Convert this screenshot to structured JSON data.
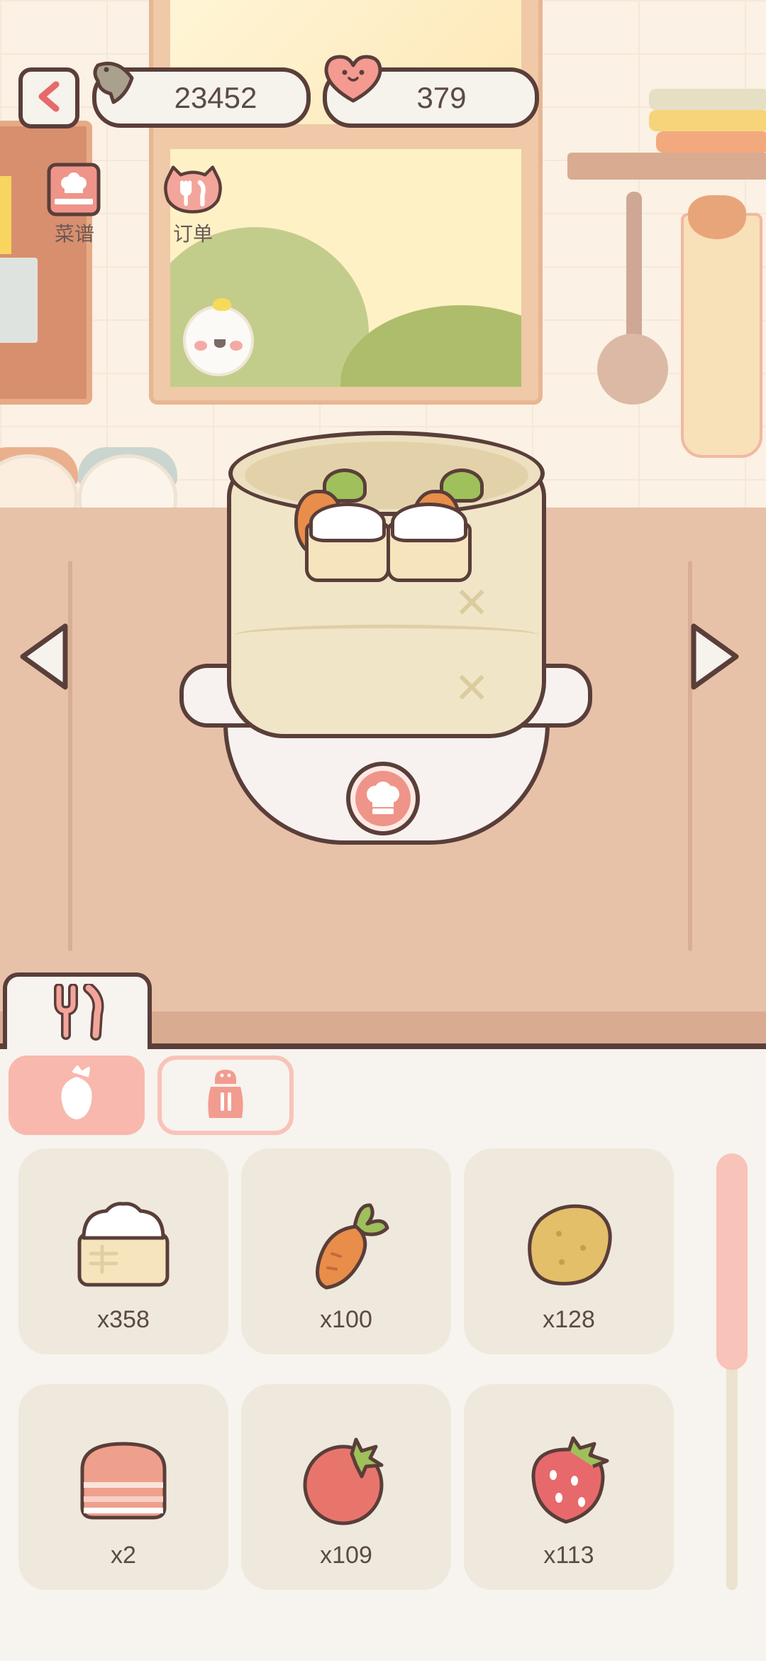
{
  "hud": {
    "back_icon": "chevron-left-icon",
    "fish_count": "23452",
    "heart_count": "379"
  },
  "menu": {
    "recipe_label": "菜谱",
    "order_label": "订单"
  },
  "ingredient_tabs": [
    {
      "icon": "carrot-icon",
      "active": true
    },
    {
      "icon": "seasoning-bottle-icon",
      "active": false
    }
  ],
  "ingredients": [
    {
      "name": "steamed-bun",
      "count": "x358"
    },
    {
      "name": "carrot",
      "count": "x100"
    },
    {
      "name": "potato",
      "count": "x128"
    },
    {
      "name": "bacon",
      "count": "x2"
    },
    {
      "name": "tomato",
      "count": "x109"
    },
    {
      "name": "strawberry",
      "count": "x113"
    }
  ],
  "colors": {
    "outline": "#5a3e3a",
    "accent": "#f8b8ad",
    "panel_bg": "#f7f3ee",
    "card_bg": "#efe9dd"
  }
}
